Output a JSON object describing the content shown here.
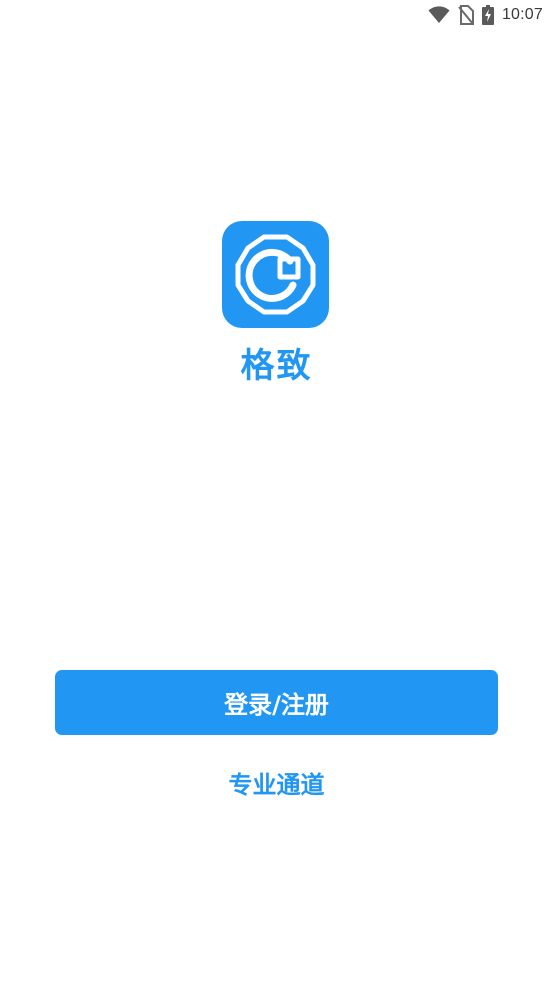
{
  "status_bar": {
    "time": "10:07",
    "icons": [
      "wifi-icon",
      "no-sim-icon",
      "battery-charging-icon"
    ]
  },
  "app": {
    "logo_icon": "app-logo-icon",
    "name": "格致",
    "brand_color": "#2196f3"
  },
  "actions": {
    "login_register_label": "登录/注册",
    "pro_channel_label": "专业通道"
  }
}
